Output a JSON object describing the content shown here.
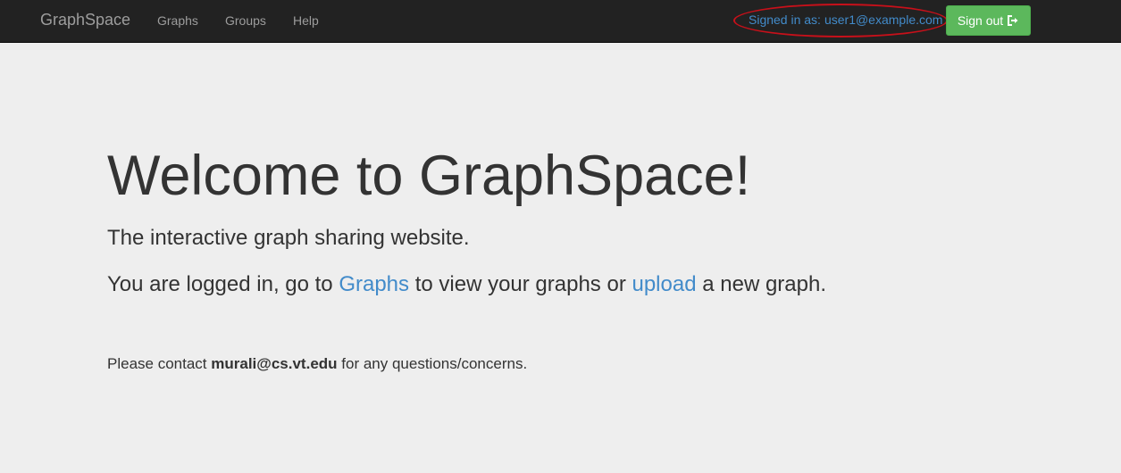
{
  "navbar": {
    "brand": "GraphSpace",
    "links": [
      "Graphs",
      "Groups",
      "Help"
    ],
    "signed_in_prefix": "Signed in as:",
    "signed_in_user": "user1@example.com",
    "signout_label": "Sign out",
    "signout_icon": "sign-out-icon"
  },
  "main": {
    "title": "Welcome to GraphSpace!",
    "subtitle": "The interactive graph sharing website.",
    "logged_in": {
      "part1": "You are logged in, go to ",
      "graphs_link": "Graphs",
      "part2": " to view your graphs or ",
      "upload_link": "upload",
      "part3": " a new graph."
    },
    "contact": {
      "prefix": "Please contact ",
      "email": "murali@cs.vt.edu",
      "suffix": " for any questions/concerns."
    }
  },
  "colors": {
    "navbar_bg": "#222222",
    "link_blue": "#428bca",
    "success_green": "#5cb85c",
    "annotation_red": "#c8101a",
    "page_bg": "#eeeeee"
  }
}
